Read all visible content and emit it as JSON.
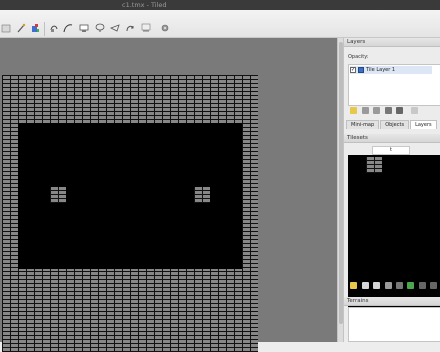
{
  "window": {
    "title": "c1.tmx - Tiled"
  },
  "toolbar": {
    "icons": [
      "new-icon",
      "open-icon",
      "save-icon",
      "stamp-brush-icon",
      "bucket-fill-icon",
      "eraser-icon",
      "rect-select-icon",
      "magic-wand-icon",
      "select-same-tile-icon",
      "random-mode-icon",
      "rotate-icon",
      "flip-horizontal-icon",
      "flip-vertical-icon",
      "settings-icon"
    ]
  },
  "layers_panel": {
    "header": "Layers",
    "opacity_label": "Opacity:",
    "layers": [
      {
        "name": "Tile Layer 1",
        "visible_check": "✓"
      }
    ]
  },
  "tabs": [
    {
      "label": "Mini-map"
    },
    {
      "label": "Objects"
    },
    {
      "label": "Layers"
    }
  ],
  "tilesets_panel": {
    "header": "Tilesets",
    "tab_label": "t"
  },
  "properties_panel": {
    "header": "Terrains"
  },
  "colors": {
    "brick": "#878787",
    "mortar": "#111111",
    "void": "#000000",
    "canvas_bg": "#7a7a7a"
  }
}
